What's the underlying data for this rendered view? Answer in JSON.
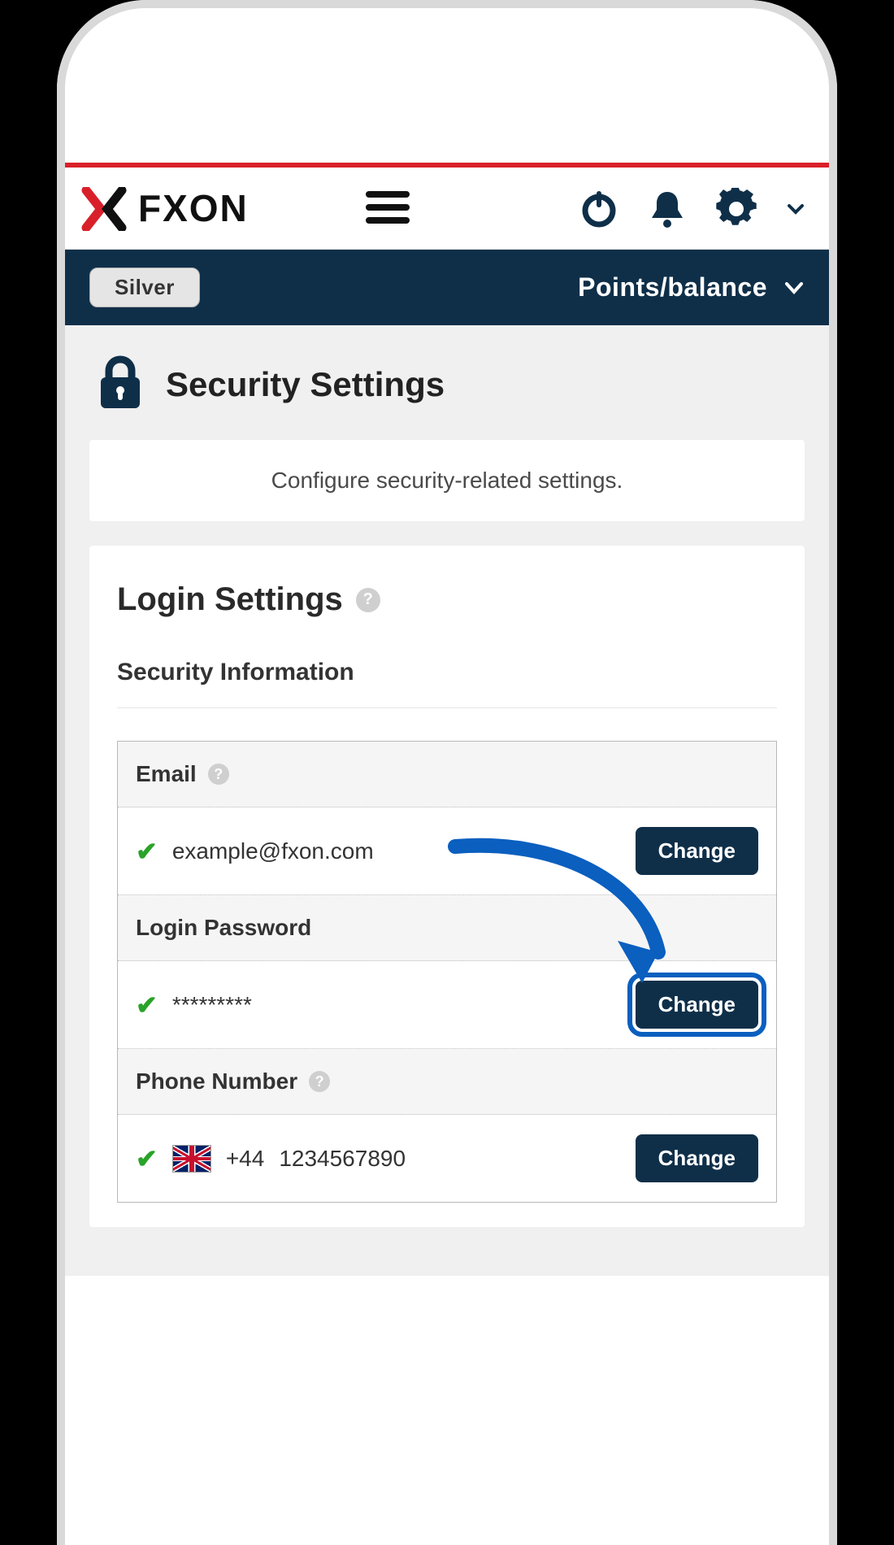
{
  "brand": {
    "name": "FXON"
  },
  "tier": {
    "label": "Silver"
  },
  "points_menu": {
    "label": "Points/balance"
  },
  "page": {
    "title": "Security Settings",
    "intro": "Configure security-related settings."
  },
  "login_settings": {
    "heading": "Login Settings",
    "subheading": "Security Information",
    "email": {
      "label": "Email",
      "value": "example@fxon.com",
      "verified": true,
      "action": "Change"
    },
    "password": {
      "label": "Login Password",
      "value": "*********",
      "verified": true,
      "action": "Change",
      "highlighted": true
    },
    "phone": {
      "label": "Phone Number",
      "country_code": "+44",
      "number": "1234567890",
      "flag": "uk",
      "verified": true,
      "action": "Change"
    }
  }
}
